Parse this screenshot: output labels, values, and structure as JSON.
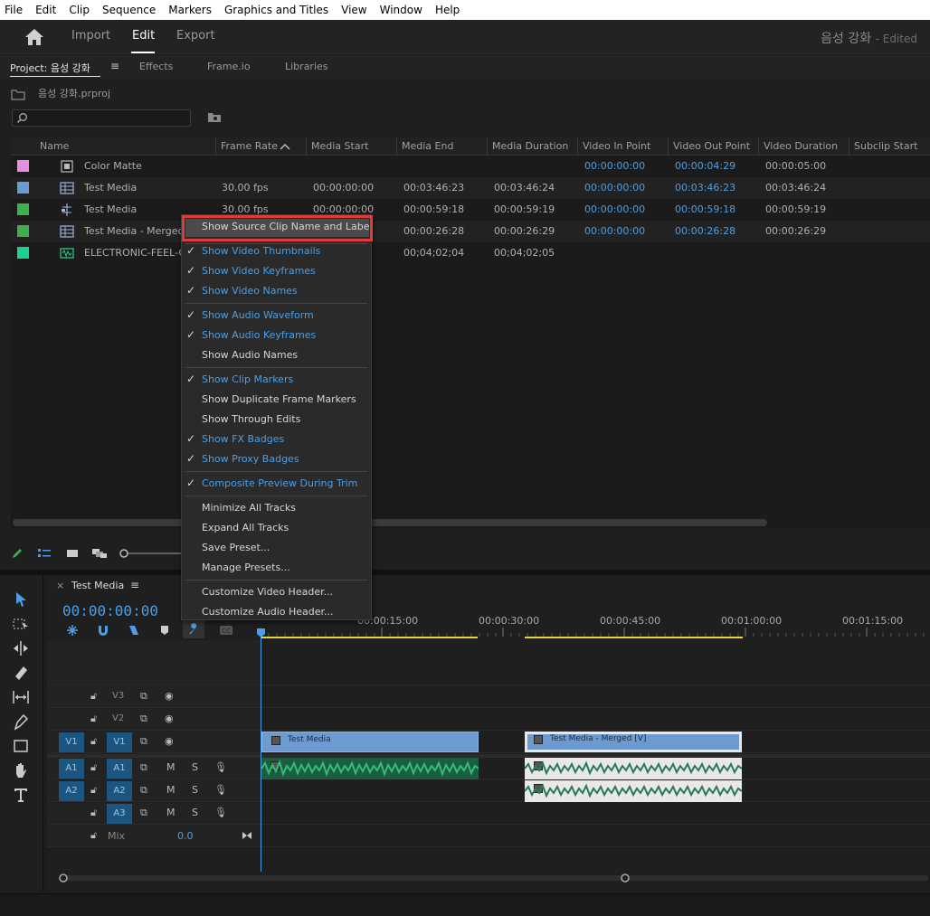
{
  "menubar": [
    "File",
    "Edit",
    "Clip",
    "Sequence",
    "Markers",
    "Graphics and Titles",
    "View",
    "Window",
    "Help"
  ],
  "header": {
    "workspaces": [
      "Import",
      "Edit",
      "Export"
    ],
    "active_workspace": "Edit",
    "project_title": "음성 강화",
    "edited_suffix": "- Edited"
  },
  "project_panel": {
    "tabs": [
      "Project: 음성 강화",
      "Effects",
      "Frame.io",
      "Libraries"
    ],
    "bin_path": "음성 강화.prproj",
    "columns": [
      "Name",
      "Frame Rate",
      "Media Start",
      "Media End",
      "Media Duration",
      "Video In Point",
      "Video Out Point",
      "Video Duration",
      "Subclip Start"
    ],
    "rows": [
      {
        "color": "#e48ee4",
        "name": "Color Matte",
        "frame_rate": "",
        "media_start": "",
        "media_end": "",
        "media_duration": "",
        "in": "00:00:00:00",
        "out": "00:00:04:29",
        "vdur": "00:00:05:00"
      },
      {
        "color": "#6e9ad2",
        "name": "Test Media",
        "frame_rate": "30.00 fps",
        "media_start": "00:00:00:00",
        "media_end": "00:03:46:23",
        "media_duration": "00:03:46:24",
        "in": "00:00:00:00",
        "out": "00:03:46:23",
        "vdur": "00:03:46:24"
      },
      {
        "color": "#3fae4f",
        "name": "Test Media",
        "frame_rate": "30.00 fps",
        "media_start": "00:00:00:00",
        "media_end": "00:00:59:18",
        "media_duration": "00:00:59:19",
        "in": "00:00:00:00",
        "out": "00:00:59:18",
        "vdur": "00:00:59:19"
      },
      {
        "color": "#3fae4f",
        "name": "Test Media - Merged",
        "frame_rate": "",
        "media_start": "",
        "media_end": "00:00:26:28",
        "media_duration": "00:00:26:29",
        "in": "00:00:00:00",
        "out": "00:00:26:28",
        "vdur": "00:00:26:29"
      },
      {
        "color": "#1fcf8f",
        "name": "ELECTRONIC-FEEL-GO",
        "frame_rate": "",
        "media_start": "",
        "media_end": "00;04;02;04",
        "media_duration": "00;04;02;05",
        "in": "",
        "out": "",
        "vdur": ""
      }
    ]
  },
  "context_menu": {
    "items": [
      {
        "label": "Show Source Clip Name and Label",
        "checked": false,
        "highlighted": true
      },
      {
        "label": "Show Video Thumbnails",
        "checked": true
      },
      {
        "label": "Show Video Keyframes",
        "checked": true
      },
      {
        "label": "Show Video Names",
        "checked": true
      },
      {
        "label": "Show Audio Waveform",
        "checked": true
      },
      {
        "label": "Show Audio Keyframes",
        "checked": true
      },
      {
        "label": "Show Audio Names",
        "checked": false
      },
      {
        "label": "Show Clip Markers",
        "checked": true
      },
      {
        "label": "Show Duplicate Frame Markers",
        "checked": false
      },
      {
        "label": "Show Through Edits",
        "checked": false
      },
      {
        "label": "Show FX Badges",
        "checked": true
      },
      {
        "label": "Show Proxy Badges",
        "checked": true
      },
      {
        "label": "Composite Preview During Trim",
        "checked": true
      },
      {
        "label": "Minimize All Tracks",
        "checked": false
      },
      {
        "label": "Expand All Tracks",
        "checked": false
      },
      {
        "label": "Save Preset...",
        "checked": false
      },
      {
        "label": "Manage Presets...",
        "checked": false
      },
      {
        "label": "Customize Video Header...",
        "checked": false
      },
      {
        "label": "Customize Audio Header...",
        "checked": false
      }
    ]
  },
  "timeline": {
    "sequence_name": "Test Media",
    "timecode": "00:00:00:00",
    "ruler_labels": [
      "00:00:15:00",
      "00:00:30:00",
      "00:00:45:00",
      "00:01:00:00",
      "00:01:15:00"
    ],
    "tracks": {
      "video": [
        "V3",
        "V2",
        "V1"
      ],
      "audio": [
        "A1",
        "A2",
        "A3"
      ],
      "source_patch_v": "V1",
      "source_patch_a": [
        "A1",
        "A2"
      ]
    },
    "mix_label": "Mix",
    "mix_value": "0.0",
    "clips": {
      "v1_clip1": "Test Media",
      "v1_clip2": "Test Media - Merged [V]"
    },
    "track_buttons": {
      "mute": "M",
      "solo": "S"
    }
  },
  "colors": {
    "accent_blue": "#4a9fe8",
    "highlight_red": "#e03a3a",
    "audio_green": "#2fbf7a"
  }
}
